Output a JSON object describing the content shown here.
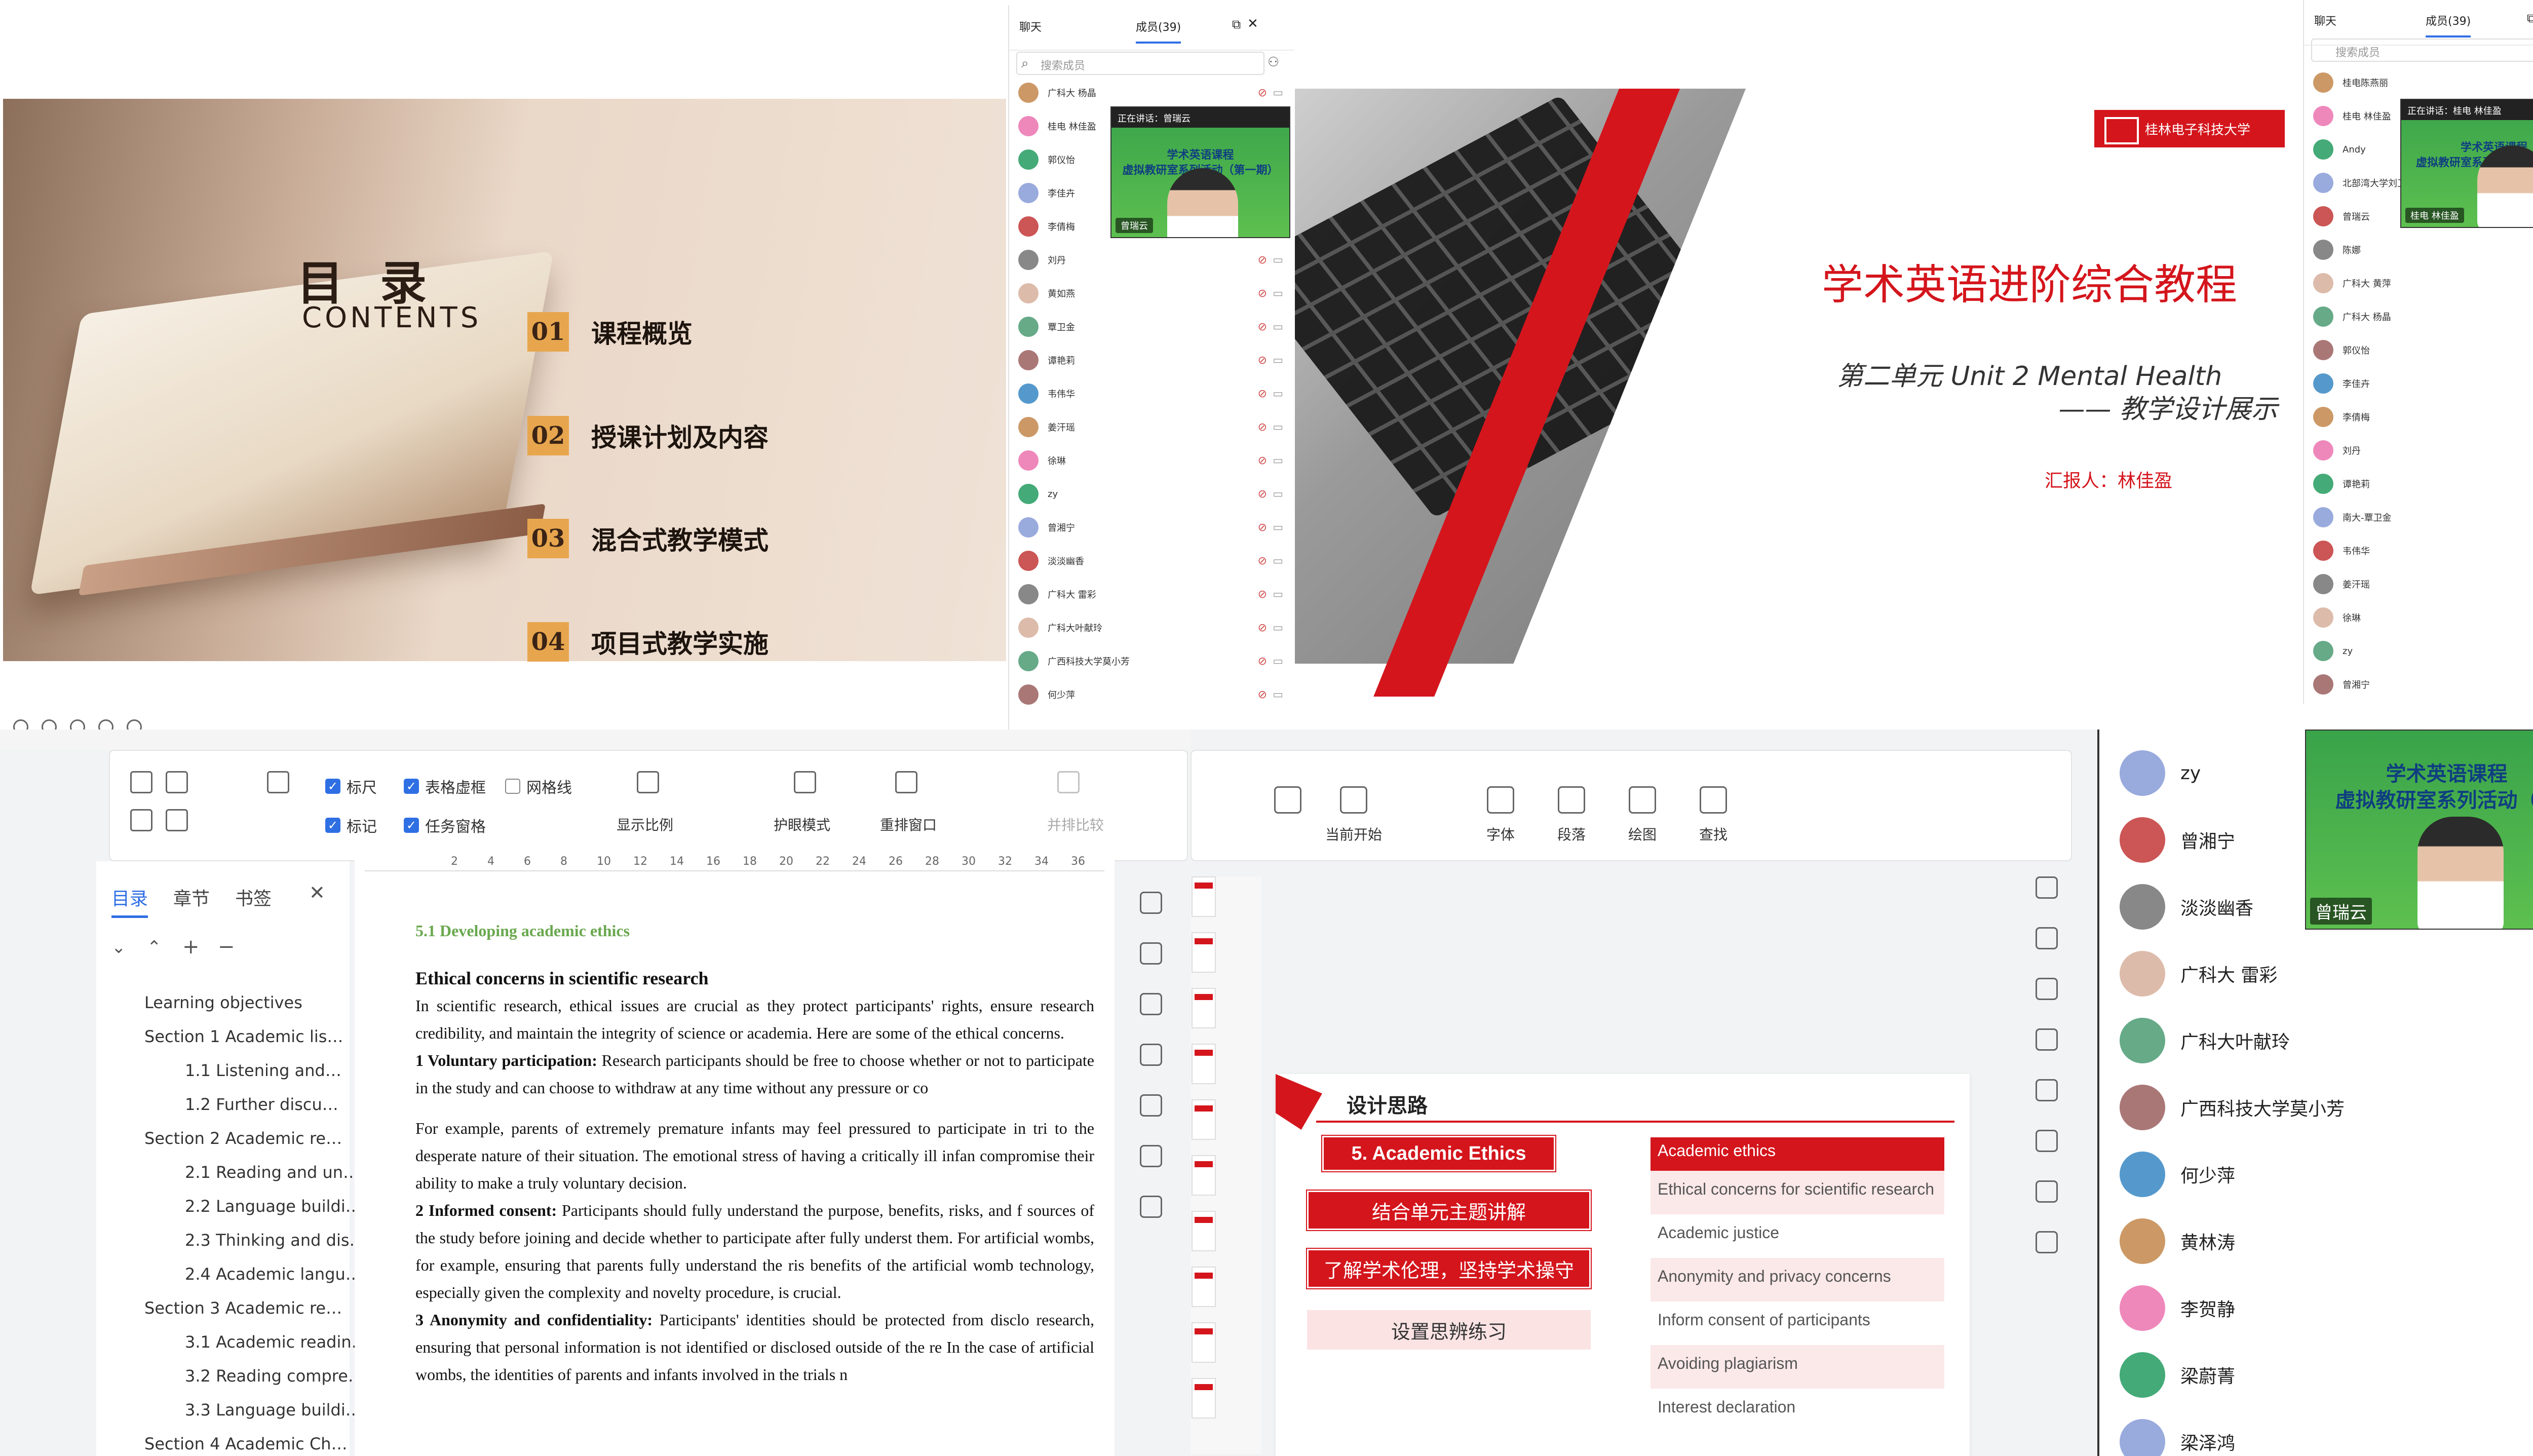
{
  "q1": {
    "slide": {
      "title": "目 录",
      "subtitle": "CONTENTS",
      "items": [
        {
          "num": "01",
          "text": "课程概览"
        },
        {
          "num": "02",
          "text": "授课计划及内容"
        },
        {
          "num": "03",
          "text": "混合式教学模式"
        },
        {
          "num": "04",
          "text": "项目式教学实施"
        }
      ]
    },
    "chat": {
      "tab_chat": "聊天",
      "tab_members": "成员(39)",
      "search_placeholder": "搜索成员",
      "speaking": "正在讲话：曾瑞云",
      "video_title_1": "学术英语课程",
      "video_title_2": "虚拟教研室系列活动（第一期）",
      "video_tag": "曾瑞云",
      "members": [
        "广科大 杨晶",
        "桂电 林佳盈",
        "郭仪怡",
        "李佳卉",
        "李倩梅",
        "刘丹",
        "黄如燕",
        "覃卫金",
        "谭艳莉",
        "韦伟华",
        "姜汗瑶",
        "徐琳",
        "zy",
        "曾湘宁",
        "淡淡幽香",
        "广科大 雷彩",
        "广科大叶献玲",
        "广西科技大学莫小芳",
        "何少萍"
      ]
    }
  },
  "q2": {
    "uni": "桂林电子科技大学",
    "title": "学术英语进阶综合教程",
    "sub1": "第二单元 Unit 2 Mental Health",
    "sub2": "—— 教学设计展示",
    "reporter": "汇报人：林佳盈",
    "chat": {
      "tab_chat": "聊天",
      "tab_members": "成员(39)",
      "search_placeholder": "搜索成员",
      "speaking": "正在讲话：桂电 林佳盈",
      "video_title_1": "学术英语课程",
      "video_title_2": "虚拟教研室系列活动（第一期）",
      "video_tag": "桂电 林佳盈",
      "members": [
        "桂电陈燕丽",
        "桂电 林佳盈",
        "Andy",
        "北部湾大学刘卫",
        "曾瑞云",
        "陈娜",
        "广科大 黄萍",
        "广科大 杨晶",
        "郭仪怡",
        "李佳卉",
        "李倩梅",
        "刘丹",
        "谭艳莉",
        "南大-覃卫金",
        "韦伟华",
        "姜汗瑶",
        "徐琳",
        "zy",
        "曾湘宁"
      ]
    }
  },
  "q3": {
    "ribbon": {
      "ruler": "标尺",
      "table_grid": "表格虚框",
      "gridlines": "网格线",
      "marks": "标记",
      "task_pane": "任务窗格",
      "zoom": "显示比例",
      "eye_mode": "护眼模式",
      "rearrange": "重排窗口",
      "compare": "并排比较"
    },
    "nav_tabs": [
      "目录",
      "章节",
      "书签"
    ],
    "nav_items": [
      {
        "text": "Learning objectives",
        "level": 0
      },
      {
        "text": "Section 1 Academic lis…",
        "level": 0
      },
      {
        "text": "1.1 Listening and…",
        "level": 1
      },
      {
        "text": "1.2 Further discu…",
        "level": 1
      },
      {
        "text": "Section 2 Academic re…",
        "level": 0
      },
      {
        "text": "2.1 Reading and un…",
        "level": 1
      },
      {
        "text": "2.2 Language buildi…",
        "level": 1
      },
      {
        "text": "2.3 Thinking and dis…",
        "level": 1
      },
      {
        "text": "2.4 Academic langu…",
        "level": 1
      },
      {
        "text": "Section 3 Academic re…",
        "level": 0
      },
      {
        "text": "3.1 Academic readin…",
        "level": 1
      },
      {
        "text": "3.2 Reading compre…",
        "level": 1
      },
      {
        "text": "3.3 Language buildi…",
        "level": 1
      },
      {
        "text": "Section 4 Academic Ch…",
        "level": 0
      }
    ],
    "ruler_ticks": [
      "2",
      "4",
      "6",
      "8",
      "10",
      "12",
      "14",
      "16",
      "18",
      "20",
      "22",
      "24",
      "26",
      "28",
      "30",
      "32",
      "34",
      "36"
    ],
    "doc": {
      "heading": "5.1 Developing academic ethics",
      "sub": "Ethical concerns in scientific research",
      "p1": "In scientific research, ethical issues are crucial as they protect participants' rights, ensure research credibility, and maintain the integrity of science or academia. Here are some of the ethical concerns.",
      "p2_bold": "1 Voluntary participation:",
      "p2": " Research participants should be free to choose whether or not to participate in the study and can choose to withdraw at any time without any pressure or co",
      "p3": "For example, parents of extremely premature infants may feel pressured to participate in tri to the desperate nature of their situation. The emotional stress of having a critically ill infan compromise their ability to make a truly voluntary decision.",
      "p4_bold": "2 Informed consent:",
      "p4": " Participants should fully understand the purpose, benefits, risks, and f sources of the study before joining and decide whether to participate after fully underst them. For artificial wombs, for example, ensuring that parents fully understand the ris benefits of the artificial womb technology, especially given the complexity and novelty procedure, is crucial.",
      "p5_bold": "3 Anonymity and confidentiality:",
      "p5": " Participants' identities should be protected from disclo research, ensuring that personal information is not identified or disclosed outside of the re In the case of artificial wombs, the identities of parents and infants involved in the trials n"
    }
  },
  "q4": {
    "ribbon": {
      "from_start": "当前开始",
      "font": "字体",
      "paragraph": "段落",
      "draw": "绘图",
      "find": "查找"
    },
    "slide": {
      "title": "设计思路",
      "left_boxes": [
        "5. Academic Ethics",
        "结合单元主题讲解",
        "了解学术伦理，坚持学术操守",
        "设置思辨练习"
      ],
      "ae_header": "Academic ethics",
      "ae_rows": [
        "Ethical concerns for scientific research",
        "Academic justice",
        "Anonymity and  privacy concerns",
        "Inform consent of participants",
        "Avoiding plagiarism",
        "Interest declaration"
      ]
    },
    "video": {
      "title_1": "学术英语课程",
      "title_2": "虚拟教研室系列活动（第",
      "tag": "曾瑞云"
    },
    "members": [
      "zy",
      "曾湘宁",
      "淡淡幽香",
      "广科大 雷彩",
      "广科大叶献玲",
      "广西科技大学莫小芳",
      "何少萍",
      "黄林涛",
      "李贺静",
      "梁蔚菁",
      "梁泽鸿"
    ]
  },
  "colors": {
    "accent_red": "#d4151c",
    "word_blue": "#2f6fe4",
    "toc_gold": "#e7a64e"
  }
}
